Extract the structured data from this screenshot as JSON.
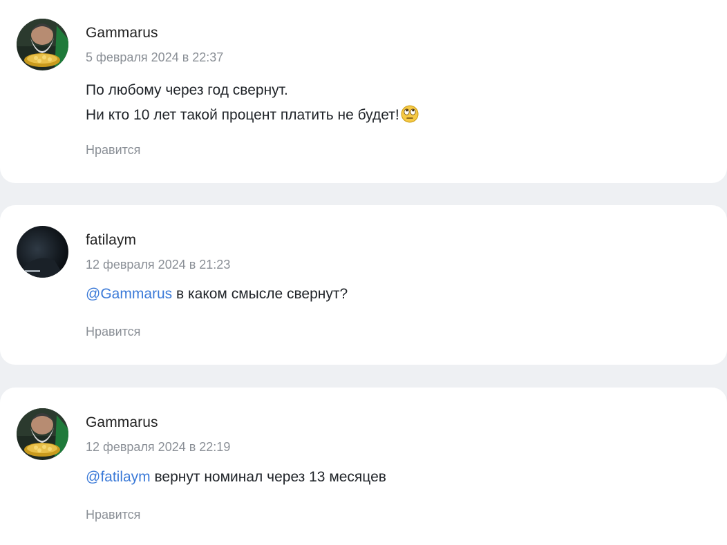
{
  "comments": [
    {
      "author": "Gammarus",
      "avatar_icon": "gnome-with-gold-avatar",
      "date": "5 февраля 2024 в 22:37",
      "lines": [
        {
          "mention": "",
          "text": "По любому через год свернут."
        },
        {
          "mention": "",
          "text": "Ни кто 10 лет такой процент платить не будет!"
        }
      ],
      "emoji": "face-with-rolling-eyes-icon",
      "like_label": "Нравится"
    },
    {
      "author": "fatilaym",
      "avatar_icon": "dark-photo-avatar",
      "date": "12 февраля 2024 в 21:23",
      "lines": [
        {
          "mention": "@Gammarus",
          "text": " в каком смысле свернут?"
        }
      ],
      "like_label": "Нравится"
    },
    {
      "author": "Gammarus",
      "avatar_icon": "gnome-with-gold-avatar",
      "date": "12 февраля 2024 в 22:19",
      "lines": [
        {
          "mention": "@fatilaym",
          "text": " вернут номинал через 13 месяцев"
        }
      ],
      "like_label": "Нравится"
    }
  ],
  "colors": {
    "background": "#eef0f3",
    "card": "#ffffff",
    "mention": "#3b7ad8",
    "muted": "#8a8f96",
    "text": "#1f2328"
  }
}
